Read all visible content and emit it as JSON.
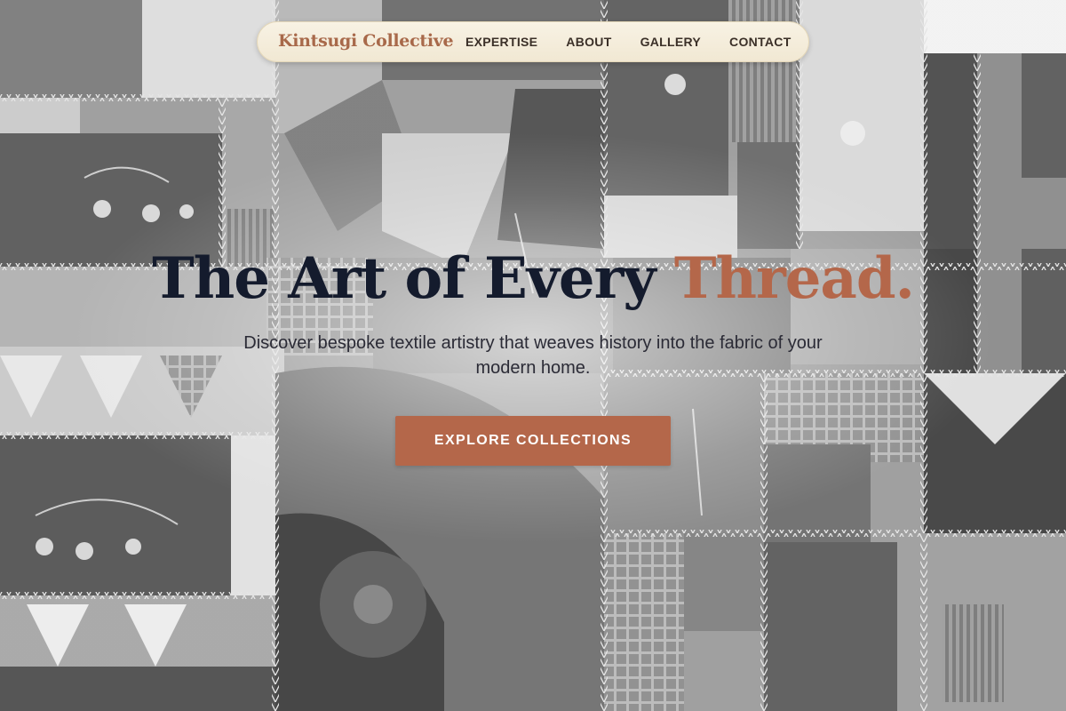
{
  "brand": {
    "name": "Kintsugi Collective"
  },
  "nav": {
    "items": [
      {
        "label": "EXPERTISE"
      },
      {
        "label": "ABOUT"
      },
      {
        "label": "GALLERY"
      },
      {
        "label": "CONTACT"
      }
    ]
  },
  "hero": {
    "headline_main": "The Art of Every ",
    "headline_accent": "Thread.",
    "subhead": "Discover bespoke textile artistry that weaves history into the fabric of your modern home.",
    "cta_label": "EXPLORE COLLECTIONS",
    "background": "crazy-quilt-photo"
  },
  "colors": {
    "accent": "#b4674a",
    "headline": "#141b2d",
    "navbar_bg": "#f6efdf",
    "nav_text": "#3b3028"
  }
}
